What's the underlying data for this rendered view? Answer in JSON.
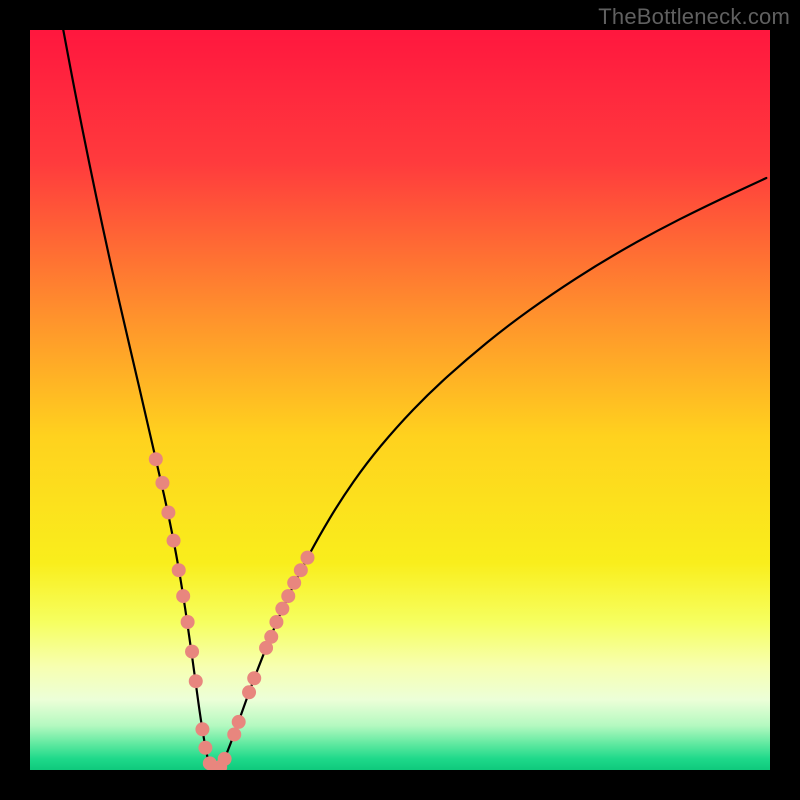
{
  "watermark": "TheBottleneck.com",
  "chart_data": {
    "type": "line",
    "title": "",
    "xlabel": "",
    "ylabel": "",
    "xlim": [
      0,
      100
    ],
    "ylim": [
      0,
      100
    ],
    "background": {
      "type": "vertical-gradient",
      "stops": [
        {
          "offset": 0.0,
          "color": "#ff173e"
        },
        {
          "offset": 0.18,
          "color": "#ff3b3d"
        },
        {
          "offset": 0.38,
          "color": "#ff8f2d"
        },
        {
          "offset": 0.55,
          "color": "#ffd21e"
        },
        {
          "offset": 0.72,
          "color": "#f9ee1c"
        },
        {
          "offset": 0.8,
          "color": "#f6ff60"
        },
        {
          "offset": 0.86,
          "color": "#f7ffb0"
        },
        {
          "offset": 0.905,
          "color": "#ecffd8"
        },
        {
          "offset": 0.94,
          "color": "#b4f9c0"
        },
        {
          "offset": 0.965,
          "color": "#5fe9a0"
        },
        {
          "offset": 0.985,
          "color": "#1ed98a"
        },
        {
          "offset": 1.0,
          "color": "#0fc97c"
        }
      ]
    },
    "series": [
      {
        "name": "bottleneck-curve",
        "color": "#000000",
        "stroke_width": 2.2,
        "x": [
          4.5,
          6,
          8,
          10,
          12,
          14,
          15.5,
          17,
          18.5,
          19.8,
          20.8,
          21.6,
          22.3,
          22.9,
          23.5,
          24,
          24.5,
          25,
          25.5,
          26.2,
          27,
          28,
          29.2,
          30.6,
          32.3,
          34.2,
          36.5,
          39,
          42,
          45.5,
          49.5,
          54,
          59,
          64.5,
          70.5,
          77,
          84,
          91.5,
          99.5
        ],
        "y": [
          100,
          92,
          82,
          72.5,
          63.5,
          55,
          48.5,
          42,
          35.5,
          29,
          23,
          17.5,
          12.5,
          8,
          4.2,
          1.5,
          0.2,
          0,
          0.2,
          1.3,
          3.3,
          6.0,
          9.4,
          13.2,
          17.5,
          22.0,
          26.8,
          31.5,
          36.5,
          41.5,
          46.3,
          51.0,
          55.5,
          60.0,
          64.3,
          68.5,
          72.5,
          76.3,
          80.0
        ]
      }
    ],
    "markers": {
      "name": "highlight-dots",
      "color": "#e8867e",
      "radius": 7,
      "points": [
        {
          "x": 17.0,
          "y": 42.0
        },
        {
          "x": 17.9,
          "y": 38.8
        },
        {
          "x": 18.7,
          "y": 34.8
        },
        {
          "x": 19.4,
          "y": 31.0
        },
        {
          "x": 20.1,
          "y": 27.0
        },
        {
          "x": 20.7,
          "y": 23.5
        },
        {
          "x": 21.3,
          "y": 20.0
        },
        {
          "x": 21.9,
          "y": 16.0
        },
        {
          "x": 22.4,
          "y": 12.0
        },
        {
          "x": 23.3,
          "y": 5.5
        },
        {
          "x": 23.7,
          "y": 3.0
        },
        {
          "x": 24.3,
          "y": 0.9
        },
        {
          "x": 25.0,
          "y": 0.0
        },
        {
          "x": 25.7,
          "y": 0.4
        },
        {
          "x": 26.3,
          "y": 1.5
        },
        {
          "x": 27.6,
          "y": 4.8
        },
        {
          "x": 28.2,
          "y": 6.5
        },
        {
          "x": 29.6,
          "y": 10.5
        },
        {
          "x": 30.3,
          "y": 12.4
        },
        {
          "x": 31.9,
          "y": 16.5
        },
        {
          "x": 32.6,
          "y": 18.0
        },
        {
          "x": 33.3,
          "y": 20.0
        },
        {
          "x": 34.1,
          "y": 21.8
        },
        {
          "x": 34.9,
          "y": 23.5
        },
        {
          "x": 35.7,
          "y": 25.3
        },
        {
          "x": 36.6,
          "y": 27.0
        },
        {
          "x": 37.5,
          "y": 28.7
        }
      ]
    }
  }
}
